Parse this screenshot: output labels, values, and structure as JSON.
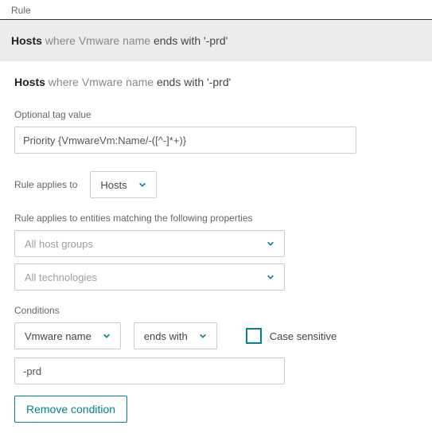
{
  "header": {
    "title": "Rule"
  },
  "summary": {
    "entity_bold": "Hosts",
    "where": "where",
    "property": "Vmware name",
    "op": "ends with",
    "value": "'-prd'"
  },
  "form": {
    "optional_tag_label": "Optional tag value",
    "optional_tag_value": "Priority {VmwareVm:Name/-([^-]*+)}",
    "applies_to_label": "Rule applies to",
    "applies_to_value": "Hosts",
    "matching_label": "Rule applies to entities matching the following properties",
    "filter_hostgroups": "All host groups",
    "filter_technologies": "All technologies",
    "conditions_label": "Conditions",
    "cond_property": "Vmware name",
    "cond_operator": "ends with",
    "case_sensitive_label": "Case sensitive",
    "cond_value": "-prd",
    "remove_condition_label": "Remove condition"
  }
}
